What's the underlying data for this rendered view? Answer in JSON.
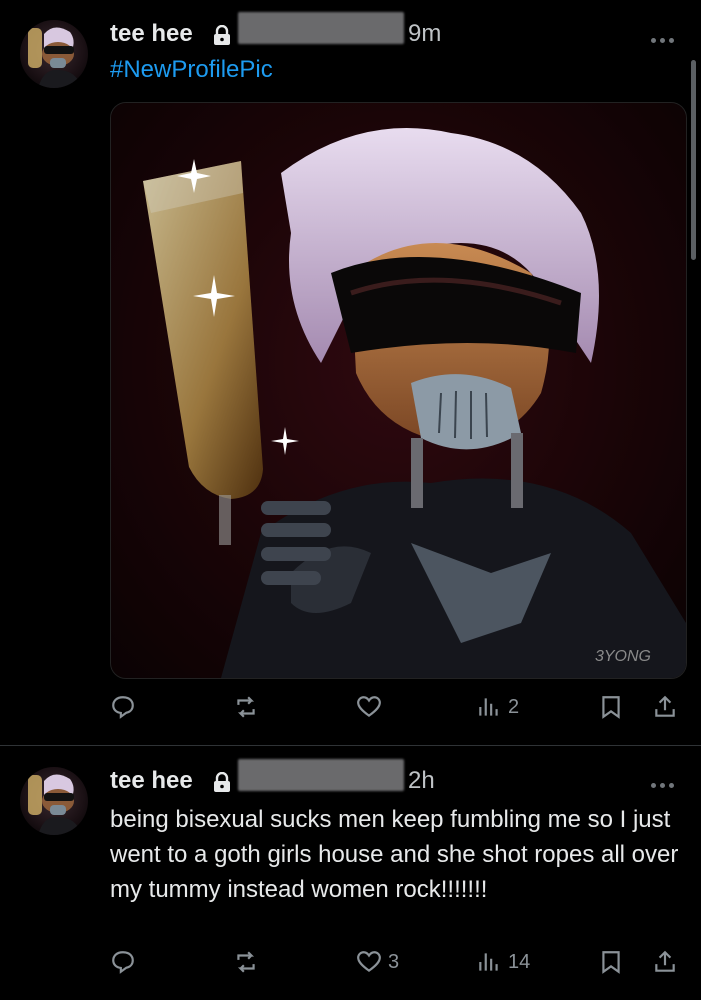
{
  "tweets": [
    {
      "display_name": "tee hee",
      "time": "9m",
      "hashtag": "#NewProfilePic",
      "image_signature": "3YONG",
      "actions": {
        "replies": "",
        "retweets": "",
        "likes": "",
        "views": "2"
      }
    },
    {
      "display_name": "tee hee",
      "time": "2h",
      "text": "being bisexual sucks men keep fumbling me so I just went to a goth girls house and she shot ropes all over my tummy instead women rock!!!!!!!",
      "actions": {
        "replies": "",
        "retweets": "",
        "likes": "3",
        "views": "14"
      }
    }
  ],
  "icons": [
    "lock-icon",
    "more-icon",
    "reply-icon",
    "retweet-icon",
    "like-icon",
    "views-icon",
    "bookmark-icon",
    "share-icon"
  ],
  "colors": {
    "background": "#000000",
    "link": "#1d9bf0",
    "muted": "#8b9298",
    "text": "#e7e9ea"
  }
}
